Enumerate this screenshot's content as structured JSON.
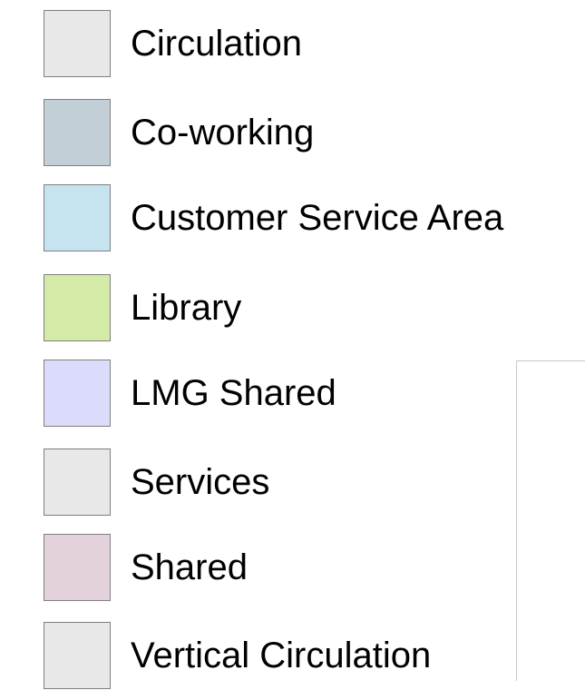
{
  "legend": {
    "items": [
      {
        "label": "Circulation",
        "color": "#e8e8e8"
      },
      {
        "label": "Co-working",
        "color": "#c3cfd6"
      },
      {
        "label": "Customer Service Area",
        "color": "#c6e3f0"
      },
      {
        "label": "Library",
        "color": "#d4eaa7"
      },
      {
        "label": "LMG Shared",
        "color": "#dbdcfc"
      },
      {
        "label": "Services",
        "color": "#e8e8e8"
      },
      {
        "label": "Shared",
        "color": "#e3d2db"
      },
      {
        "label": "Vertical Circulation",
        "color": "#e8e8e8"
      }
    ]
  }
}
